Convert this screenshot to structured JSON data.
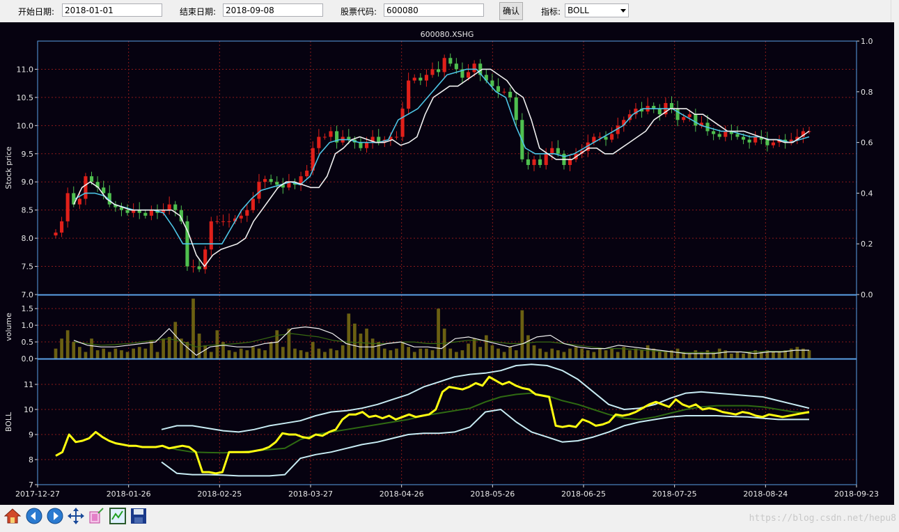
{
  "toolbar": {
    "start_label": "开始日期:",
    "start_value": "2018-01-01",
    "end_label": "结束日期:",
    "end_value": "2018-09-08",
    "code_label": "股票代码:",
    "code_value": "600080",
    "confirm_label": "确认",
    "indicator_label": "指标:",
    "indicator_value": "BOLL"
  },
  "chart_title": "600080.XSHG",
  "watermark": "https://blog.csdn.net/hepu8",
  "navbar_icons": [
    "home-icon",
    "back-icon",
    "forward-icon",
    "pan-icon",
    "zoom-icon",
    "configure-subplots-icon",
    "save-icon"
  ],
  "colors": {
    "background": "#060210",
    "axes_frame": "#5aa0e6",
    "grid": "#8a1a1a",
    "up": "#e0201a",
    "down": "#4fc04f",
    "ma_short": "#f0f0f0",
    "ma_long": "#4ec6e6",
    "volume_bar": "#6b6012",
    "vol_ma_short": "#f0f0f0",
    "vol_ma_long": "#3a6a12",
    "boll_close": "#ffff10",
    "boll_mid": "#2f6a12",
    "boll_band": "#c8ecf4"
  },
  "chart_data": [
    {
      "type": "candlestick",
      "title": "600080.XSHG",
      "ylabel": "Stock price",
      "ylim": [
        7.0,
        11.5
      ],
      "y_ticks": [
        "7.0",
        "7.5",
        "8.0",
        "8.5",
        "9.0",
        "9.5",
        "10.0",
        "10.5",
        "11.0"
      ],
      "y2lim": [
        0.0,
        1.0
      ],
      "y2_ticks": [
        "0.0",
        "0.2",
        "0.4",
        "0.6",
        "0.8",
        "1.0"
      ],
      "x_ticks": [
        "2017-12-27",
        "2018-01-26",
        "2018-02-25",
        "2018-03-27",
        "2018-04-26",
        "2018-05-26",
        "2018-06-25",
        "2018-07-25",
        "2018-08-24",
        "2018-09-23"
      ],
      "close": [
        8.1,
        8.3,
        8.8,
        8.6,
        8.7,
        9.1,
        9.0,
        8.9,
        8.8,
        8.6,
        8.55,
        8.5,
        8.45,
        8.5,
        8.45,
        8.4,
        8.5,
        8.45,
        8.5,
        8.6,
        8.5,
        8.3,
        7.5,
        7.5,
        7.45,
        7.8,
        8.3,
        8.3,
        8.3,
        8.3,
        8.35,
        8.4,
        8.5,
        8.7,
        9.0,
        9.05,
        9.0,
        8.95,
        8.9,
        9.0,
        8.95,
        9.1,
        9.2,
        9.6,
        9.8,
        9.8,
        9.9,
        9.7,
        9.8,
        9.75,
        9.7,
        9.6,
        9.7,
        9.8,
        9.7,
        9.75,
        9.8,
        9.8,
        10.3,
        10.8,
        10.85,
        10.8,
        10.9,
        11.0,
        10.95,
        11.2,
        11.1,
        11.0,
        10.85,
        10.95,
        11.1,
        10.9,
        10.8,
        10.7,
        10.6,
        10.6,
        10.5,
        10.1,
        9.4,
        9.3,
        9.4,
        9.3,
        9.5,
        9.6,
        9.5,
        9.3,
        9.4,
        9.5,
        9.55,
        9.7,
        9.8,
        9.8,
        9.75,
        9.85,
        10.0,
        10.1,
        10.2,
        10.3,
        10.25,
        10.35,
        10.3,
        10.2,
        10.4,
        10.3,
        10.1,
        10.15,
        10.2,
        10.0,
        10.05,
        9.9,
        9.85,
        9.8,
        9.9,
        9.85,
        9.8,
        9.75,
        9.7,
        9.8,
        9.75,
        9.65,
        9.7,
        9.75,
        9.7,
        9.75,
        9.8,
        9.9,
        9.9
      ],
      "ma_short": [
        8.6,
        8.9,
        9.0,
        8.9,
        8.7,
        8.6,
        8.55,
        8.5,
        8.5,
        8.5,
        8.5,
        8.5,
        8.5,
        8.4,
        8.1,
        7.7,
        7.5,
        7.7,
        7.8,
        7.85,
        7.9,
        8.0,
        8.3,
        8.5,
        8.7,
        8.9,
        9.0,
        9.0,
        8.95,
        8.9,
        8.9,
        9.1,
        9.5,
        9.6,
        9.75,
        9.8,
        9.75,
        9.7,
        9.7,
        9.75,
        9.65,
        9.7,
        9.8,
        10.2,
        10.5,
        10.6,
        10.7,
        10.7,
        10.8,
        10.9,
        11.0,
        11.0,
        10.9,
        10.8,
        10.6,
        10.5,
        10.1,
        9.6,
        9.5,
        9.4,
        9.4,
        9.4,
        9.5,
        9.6,
        9.6,
        9.5,
        9.5,
        9.6,
        9.7,
        9.8,
        9.9,
        10.1,
        10.2,
        10.3,
        10.3,
        10.3,
        10.2,
        10.2,
        10.1,
        10.0,
        9.9,
        9.9,
        9.9,
        9.85,
        9.8,
        9.75,
        9.75,
        9.7,
        9.7,
        9.8,
        9.9
      ],
      "ma_long": [
        8.7,
        8.8,
        8.8,
        8.75,
        8.6,
        8.55,
        8.5,
        8.5,
        8.5,
        8.45,
        8.2,
        7.9,
        7.9,
        7.9,
        7.9,
        7.9,
        8.2,
        8.5,
        8.7,
        8.85,
        8.9,
        8.95,
        9.0,
        8.95,
        9.1,
        9.5,
        9.7,
        9.75,
        9.75,
        9.7,
        9.7,
        9.7,
        9.75,
        10.1,
        10.2,
        10.3,
        10.5,
        10.7,
        10.9,
        10.95,
        11.0,
        11.0,
        10.8,
        10.6,
        10.5,
        10.0,
        9.6,
        9.5,
        9.5,
        9.5,
        9.45,
        9.5,
        9.6,
        9.7,
        9.8,
        9.9,
        10.0,
        10.2,
        10.3,
        10.3,
        10.3,
        10.3,
        10.2,
        10.1,
        10.0,
        9.95,
        9.9,
        9.9,
        9.85,
        9.8,
        9.8,
        9.75,
        9.75,
        9.7,
        9.75,
        9.8
      ]
    },
    {
      "type": "bar",
      "ylabel": "volume",
      "ylim": [
        0.0,
        1.9
      ],
      "y_ticks": [
        "0.0",
        "0.5",
        "1.0",
        "1.5"
      ],
      "values": [
        0.3,
        0.6,
        0.85,
        0.5,
        0.35,
        0.2,
        0.6,
        0.25,
        0.3,
        0.2,
        0.3,
        0.25,
        0.2,
        0.3,
        0.35,
        0.3,
        0.55,
        0.2,
        0.6,
        0.65,
        1.1,
        0.6,
        0.5,
        1.8,
        0.75,
        0.4,
        0.2,
        0.85,
        0.5,
        0.25,
        0.2,
        0.3,
        0.25,
        0.35,
        0.3,
        0.25,
        0.5,
        0.85,
        0.35,
        0.9,
        0.3,
        0.25,
        0.2,
        0.5,
        0.3,
        0.2,
        0.3,
        0.25,
        0.4,
        1.35,
        1.05,
        0.75,
        0.9,
        0.6,
        0.5,
        0.3,
        0.25,
        0.3,
        0.5,
        0.35,
        0.2,
        0.3,
        0.3,
        0.25,
        1.5,
        0.9,
        0.3,
        0.2,
        0.25,
        0.45,
        0.6,
        0.35,
        0.7,
        0.4,
        0.3,
        0.2,
        0.35,
        0.25,
        1.45,
        0.7,
        0.4,
        0.3,
        0.2,
        0.3,
        0.25,
        0.2,
        0.3,
        0.35,
        0.3,
        0.25,
        0.2,
        0.3,
        0.25,
        0.3,
        0.2,
        0.35,
        0.25,
        0.3,
        0.25,
        0.4,
        0.3,
        0.2,
        0.2,
        0.25,
        0.3,
        0.2,
        0.15,
        0.25,
        0.2,
        0.25,
        0.2,
        0.3,
        0.25,
        0.15,
        0.2,
        0.15,
        0.2,
        0.25,
        0.2,
        0.25,
        0.2,
        0.2,
        0.25,
        0.3,
        0.35,
        0.3,
        0.25
      ],
      "ma_short": [
        0.55,
        0.4,
        0.35,
        0.35,
        0.4,
        0.45,
        0.5,
        0.9,
        0.45,
        0.1,
        0.35,
        0.4,
        0.35,
        0.35,
        0.45,
        0.5,
        0.9,
        0.95,
        0.9,
        0.75,
        0.45,
        0.35,
        0.35,
        0.45,
        0.5,
        0.35,
        0.35,
        0.3,
        0.6,
        0.65,
        0.55,
        0.45,
        0.35,
        0.45,
        0.65,
        0.7,
        0.45,
        0.35,
        0.3,
        0.3,
        0.4,
        0.35,
        0.3,
        0.25,
        0.2,
        0.15,
        0.15,
        0.15,
        0.2,
        0.2,
        0.15,
        0.2,
        0.2,
        0.25,
        0.25
      ],
      "ma_long": [
        0.5,
        0.45,
        0.4,
        0.42,
        0.45,
        0.5,
        0.55,
        0.6,
        0.5,
        0.35,
        0.4,
        0.42,
        0.45,
        0.5,
        0.6,
        0.7,
        0.75,
        0.7,
        0.65,
        0.55,
        0.5,
        0.48,
        0.45,
        0.45,
        0.5,
        0.5,
        0.45,
        0.45,
        0.5,
        0.55,
        0.55,
        0.5,
        0.45,
        0.45,
        0.5,
        0.5,
        0.45,
        0.4,
        0.35,
        0.3,
        0.3,
        0.28,
        0.25,
        0.22,
        0.2,
        0.18,
        0.18,
        0.18,
        0.2,
        0.2,
        0.2,
        0.22,
        0.22,
        0.25,
        0.25
      ]
    },
    {
      "type": "line",
      "ylabel": "BOLL",
      "ylim": [
        7,
        12
      ],
      "y_ticks": [
        "7",
        "8",
        "9",
        "10",
        "11"
      ],
      "series": [
        {
          "values": [
            8.15,
            8.3,
            9.0,
            8.7,
            8.75,
            8.85,
            9.1,
            8.9,
            8.75,
            8.65,
            8.6,
            8.55,
            8.55,
            8.5,
            8.5,
            8.5,
            8.55,
            8.45,
            8.5,
            8.55,
            8.5,
            8.3,
            7.5,
            7.5,
            7.45,
            7.5,
            8.3,
            8.3,
            8.3,
            8.3,
            8.35,
            8.4,
            8.5,
            8.7,
            9.05,
            9.0,
            9.0,
            8.9,
            8.85,
            9.0,
            8.95,
            9.1,
            9.2,
            9.6,
            9.8,
            9.8,
            9.9,
            9.7,
            9.75,
            9.65,
            9.75,
            9.6,
            9.7,
            9.8,
            9.7,
            9.75,
            9.8,
            10.0,
            10.7,
            10.9,
            10.85,
            10.8,
            10.9,
            11.05,
            10.95,
            11.3,
            11.15,
            11.0,
            11.1,
            10.95,
            10.85,
            10.8,
            10.6,
            10.55,
            10.5,
            9.35,
            9.3,
            9.35,
            9.3,
            9.6,
            9.5,
            9.35,
            9.4,
            9.5,
            9.8,
            9.75,
            9.8,
            9.9,
            10.05,
            10.2,
            10.3,
            10.2,
            10.1,
            10.4,
            10.2,
            10.1,
            10.2,
            10.0,
            10.05,
            10.0,
            9.9,
            9.85,
            9.8,
            9.9,
            9.85,
            9.75,
            9.7,
            9.8,
            9.75,
            9.7,
            9.75,
            9.8,
            9.85,
            9.9
          ]
        },
        {
          "values": [
            8.55,
            8.4,
            8.3,
            8.28,
            8.27,
            8.3,
            8.35,
            8.4,
            8.45,
            8.8,
            9.0,
            9.1,
            9.2,
            9.3,
            9.4,
            9.5,
            9.6,
            9.75,
            9.85,
            9.95,
            10.05,
            10.3,
            10.5,
            10.6,
            10.65,
            10.55,
            10.35,
            10.2,
            10.0,
            9.8,
            9.65,
            9.6,
            9.7,
            9.85,
            10.0,
            10.1,
            10.15,
            10.15,
            10.15,
            10.1,
            10.0,
            9.9,
            9.85
          ]
        },
        {
          "values": [
            9.2,
            9.35,
            9.35,
            9.25,
            9.15,
            9.1,
            9.2,
            9.35,
            9.45,
            9.55,
            9.75,
            9.9,
            9.95,
            10.05,
            10.2,
            10.4,
            10.6,
            10.9,
            11.1,
            11.3,
            11.4,
            11.45,
            11.55,
            11.75,
            11.8,
            11.75,
            11.55,
            11.2,
            10.7,
            10.2,
            10.0,
            10.05,
            10.2,
            10.45,
            10.65,
            10.7,
            10.65,
            10.6,
            10.55,
            10.5,
            10.35,
            10.2,
            10.05
          ]
        },
        {
          "values": [
            7.9,
            7.45,
            7.4,
            7.4,
            7.38,
            7.35,
            7.35,
            7.35,
            7.4,
            8.05,
            8.2,
            8.3,
            8.45,
            8.6,
            8.7,
            8.85,
            9.0,
            9.05,
            9.05,
            9.1,
            9.3,
            9.9,
            10.0,
            9.5,
            9.1,
            8.9,
            8.7,
            8.75,
            8.9,
            9.1,
            9.35,
            9.5,
            9.6,
            9.7,
            9.75,
            9.75,
            9.75,
            9.72,
            9.7,
            9.65,
            9.6,
            9.6,
            9.6
          ]
        }
      ]
    }
  ]
}
